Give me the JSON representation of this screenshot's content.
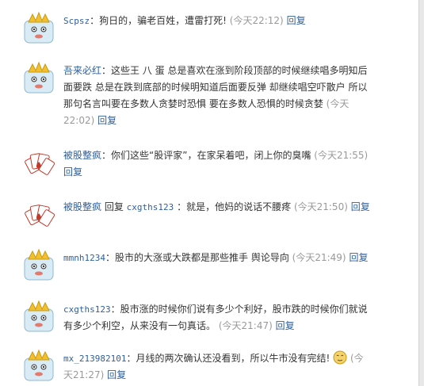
{
  "comments": [
    {
      "user": "Scpsz",
      "sep": "：",
      "text": "狗日的，骗老百姓，遭雷打死!",
      "time": "(今天22:12)",
      "reply": "回复"
    },
    {
      "user": "吾来必红",
      "sep": "：",
      "text": "这些王 八 蛋 总是喜欢在涨到阶段顶部的时候继续唱多明知后面要跌 总是在跌到底部的时候明知道后面要反弹 却继续唱空吓散户 所以那句名言叫要在多数人贪婪时恐惧 要在多数人恐惧的时候贪婪",
      "time": "(今天22:02)",
      "reply": "回复"
    },
    {
      "user": "被股整疯",
      "sep": "：",
      "text": "你们这些“股评家”，在家呆着吧，闭上你的臭嘴",
      "time": "(今天21:55)",
      "reply": "回复"
    },
    {
      "user": "被股整疯",
      "mid": " 回复 ",
      "target": "cxgths123",
      "sep": " ：",
      "text": "就是，他妈的说话不腰疼",
      "time": "(今天21:50)",
      "reply": "回复"
    },
    {
      "user": "mmnh1234",
      "sep": "：",
      "text": "股市的大涨或大跌都是那些推手 舆论导向",
      "time": "(今天21:49)",
      "reply": "回复"
    },
    {
      "user": "cxgths123",
      "sep": "：",
      "text": "股市涨的时候你们说有多少个利好，股市跌的时候你们就说有多少个利空，从来没有一句真话。",
      "time": "(今天21:47)",
      "reply": "回复"
    },
    {
      "user": "mx_213982101",
      "sep": "：",
      "text": "月线的两次确认还没看到，所以牛市没有完结!",
      "time": "(今天21:27)",
      "reply": "回复"
    }
  ]
}
